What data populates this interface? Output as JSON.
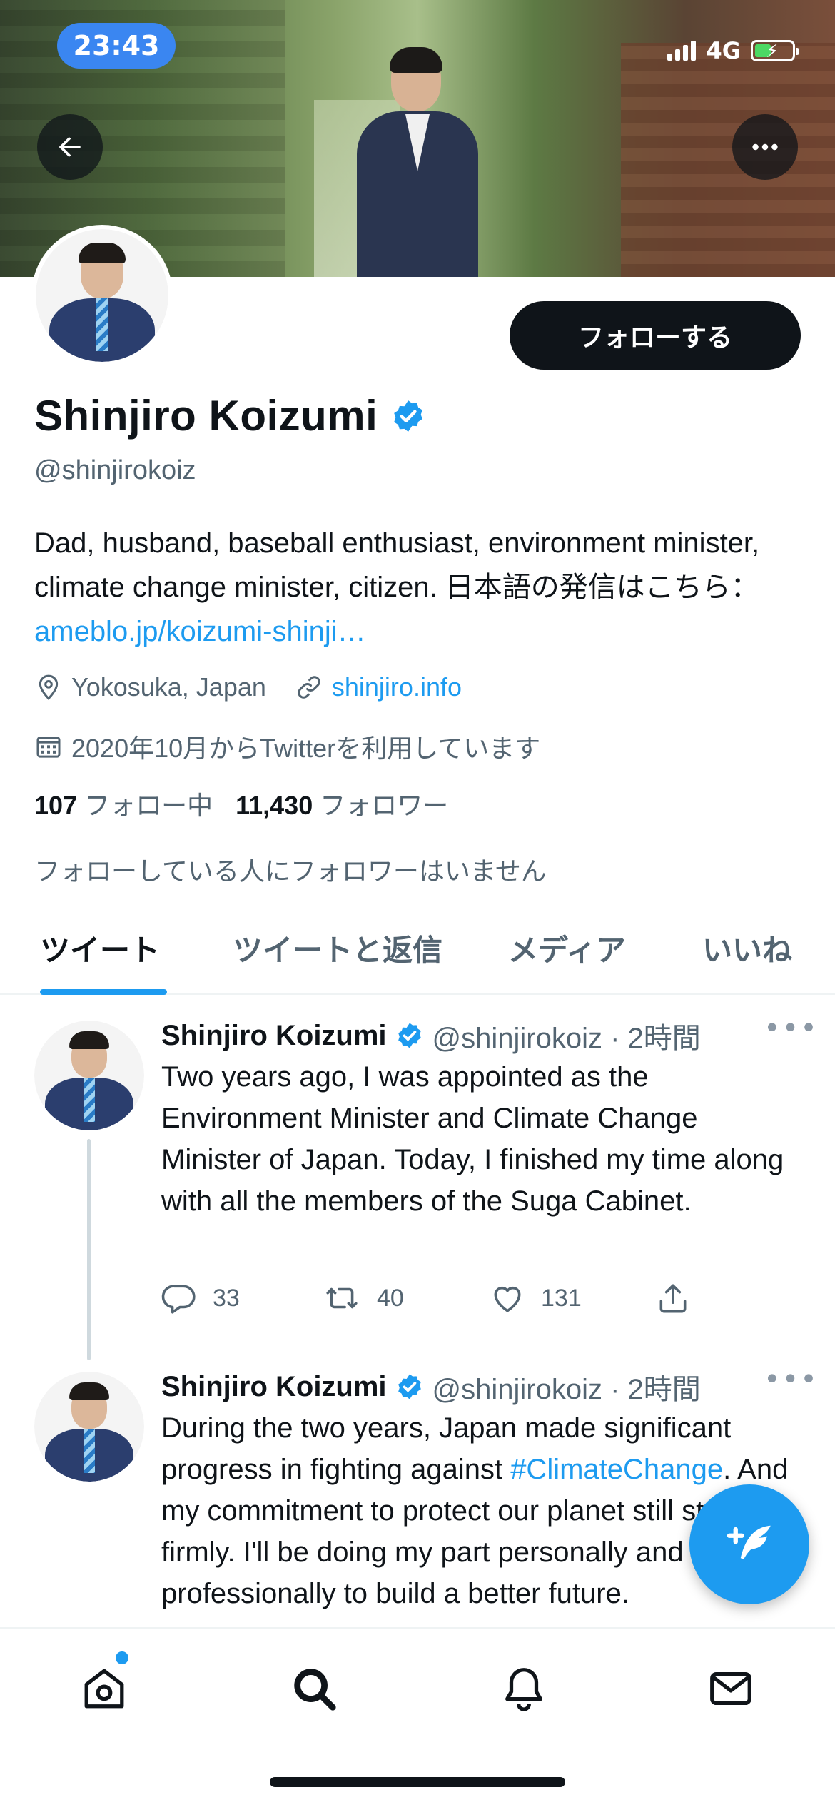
{
  "status_bar": {
    "time": "23:43",
    "network": "4G"
  },
  "header": {
    "back_icon": "arrow-left-icon",
    "more_icon": "more-horizontal-icon"
  },
  "profile": {
    "follow_label": "フォローする",
    "display_name": "Shinjiro Koizumi",
    "handle": "@shinjirokoiz",
    "bio_text": "Dad, husband, baseball enthusiast, environment minister, climate change minister, citizen. 日本語の発信はこちら：",
    "bio_link": "ameblo.jp/koizumi-shinji…",
    "location": "Yokosuka, Japan",
    "website": "shinjiro.info",
    "joined": "2020年10月からTwitterを利用しています",
    "following_count": "107",
    "following_label": "フォロー中",
    "followers_count": "11,430",
    "followers_label": "フォロワー",
    "followed_by_note": "フォローしている人にフォロワーはいません"
  },
  "tabs": [
    {
      "label": "ツイート",
      "active": true
    },
    {
      "label": "ツイートと返信",
      "active": false
    },
    {
      "label": "メディア",
      "active": false
    },
    {
      "label": "いいね",
      "active": false
    }
  ],
  "tweets": [
    {
      "name": "Shinjiro Koizumi",
      "handle_time": "@shinjirokoiz · 2時間",
      "text": "Two years ago, I was appointed as the Environment Minister and Climate Change Minister of Japan. Today, I finished my time along with all the members of the Suga Cabinet.",
      "replies": "33",
      "retweets": "40",
      "likes": "131"
    },
    {
      "name": "Shinjiro Koizumi",
      "handle_time": "@shinjirokoiz · 2時間",
      "text_before": "During the two years, Japan made significant progress in fighting against ",
      "hashtag": "#ClimateChange",
      "text_after": ". And my commitment to protect our planet still stands firmly. I'll be doing my part personally and professionally to build a better future."
    }
  ],
  "colors": {
    "accent": "#1d9bf0",
    "text": "#0f1419",
    "secondary": "#536471",
    "status_pill": "#3a86f1"
  },
  "bottom_nav": [
    "home-icon",
    "search-icon",
    "notifications-icon",
    "messages-icon"
  ],
  "fab_icon": "compose-tweet-icon"
}
